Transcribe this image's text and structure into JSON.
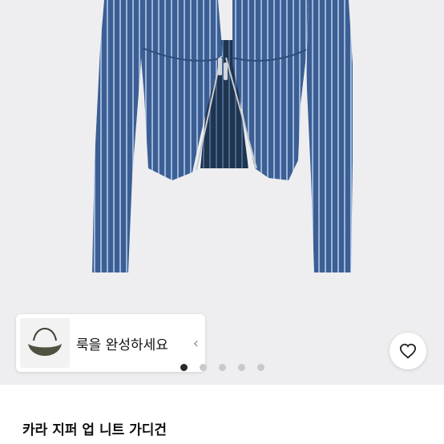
{
  "look": {
    "label": "룩을 완성하세요",
    "chevron": "‹"
  },
  "carousel": {
    "count": 5,
    "active_index": 0
  },
  "product": {
    "title": "카라 지퍼 업 니트 가디건"
  },
  "icons": {
    "wishlist": "heart-icon",
    "bag": "bag-thumbnail",
    "chevron": "chevron-left-icon"
  },
  "colors": {
    "background": "#eeeef0",
    "knit": "#3c5f94",
    "knit_stripe": "#9fb4d6"
  }
}
